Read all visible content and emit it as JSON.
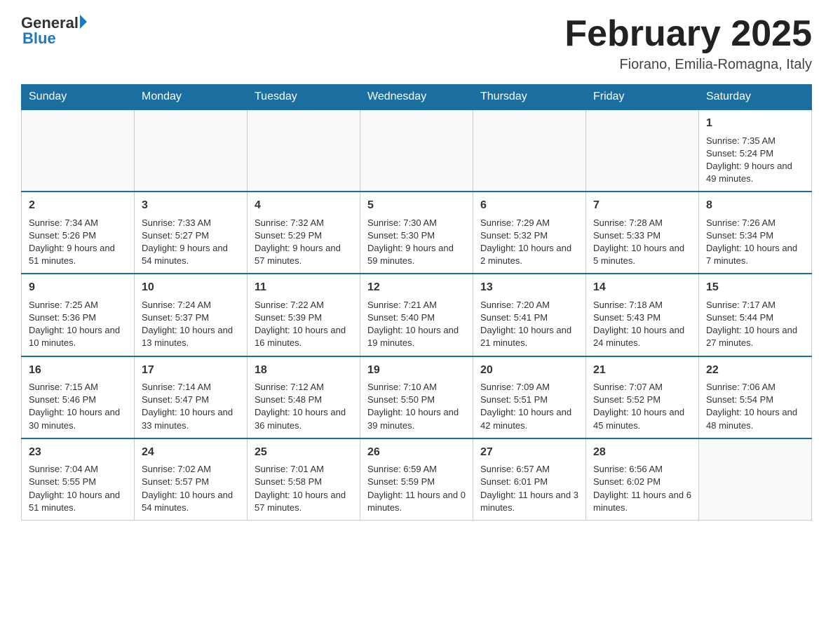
{
  "logo": {
    "text_general": "General",
    "text_blue": "Blue"
  },
  "header": {
    "month": "February 2025",
    "location": "Fiorano, Emilia-Romagna, Italy"
  },
  "weekdays": [
    "Sunday",
    "Monday",
    "Tuesday",
    "Wednesday",
    "Thursday",
    "Friday",
    "Saturday"
  ],
  "weeks": [
    [
      {
        "day": "",
        "info": ""
      },
      {
        "day": "",
        "info": ""
      },
      {
        "day": "",
        "info": ""
      },
      {
        "day": "",
        "info": ""
      },
      {
        "day": "",
        "info": ""
      },
      {
        "day": "",
        "info": ""
      },
      {
        "day": "1",
        "info": "Sunrise: 7:35 AM\nSunset: 5:24 PM\nDaylight: 9 hours and 49 minutes."
      }
    ],
    [
      {
        "day": "2",
        "info": "Sunrise: 7:34 AM\nSunset: 5:26 PM\nDaylight: 9 hours and 51 minutes."
      },
      {
        "day": "3",
        "info": "Sunrise: 7:33 AM\nSunset: 5:27 PM\nDaylight: 9 hours and 54 minutes."
      },
      {
        "day": "4",
        "info": "Sunrise: 7:32 AM\nSunset: 5:29 PM\nDaylight: 9 hours and 57 minutes."
      },
      {
        "day": "5",
        "info": "Sunrise: 7:30 AM\nSunset: 5:30 PM\nDaylight: 9 hours and 59 minutes."
      },
      {
        "day": "6",
        "info": "Sunrise: 7:29 AM\nSunset: 5:32 PM\nDaylight: 10 hours and 2 minutes."
      },
      {
        "day": "7",
        "info": "Sunrise: 7:28 AM\nSunset: 5:33 PM\nDaylight: 10 hours and 5 minutes."
      },
      {
        "day": "8",
        "info": "Sunrise: 7:26 AM\nSunset: 5:34 PM\nDaylight: 10 hours and 7 minutes."
      }
    ],
    [
      {
        "day": "9",
        "info": "Sunrise: 7:25 AM\nSunset: 5:36 PM\nDaylight: 10 hours and 10 minutes."
      },
      {
        "day": "10",
        "info": "Sunrise: 7:24 AM\nSunset: 5:37 PM\nDaylight: 10 hours and 13 minutes."
      },
      {
        "day": "11",
        "info": "Sunrise: 7:22 AM\nSunset: 5:39 PM\nDaylight: 10 hours and 16 minutes."
      },
      {
        "day": "12",
        "info": "Sunrise: 7:21 AM\nSunset: 5:40 PM\nDaylight: 10 hours and 19 minutes."
      },
      {
        "day": "13",
        "info": "Sunrise: 7:20 AM\nSunset: 5:41 PM\nDaylight: 10 hours and 21 minutes."
      },
      {
        "day": "14",
        "info": "Sunrise: 7:18 AM\nSunset: 5:43 PM\nDaylight: 10 hours and 24 minutes."
      },
      {
        "day": "15",
        "info": "Sunrise: 7:17 AM\nSunset: 5:44 PM\nDaylight: 10 hours and 27 minutes."
      }
    ],
    [
      {
        "day": "16",
        "info": "Sunrise: 7:15 AM\nSunset: 5:46 PM\nDaylight: 10 hours and 30 minutes."
      },
      {
        "day": "17",
        "info": "Sunrise: 7:14 AM\nSunset: 5:47 PM\nDaylight: 10 hours and 33 minutes."
      },
      {
        "day": "18",
        "info": "Sunrise: 7:12 AM\nSunset: 5:48 PM\nDaylight: 10 hours and 36 minutes."
      },
      {
        "day": "19",
        "info": "Sunrise: 7:10 AM\nSunset: 5:50 PM\nDaylight: 10 hours and 39 minutes."
      },
      {
        "day": "20",
        "info": "Sunrise: 7:09 AM\nSunset: 5:51 PM\nDaylight: 10 hours and 42 minutes."
      },
      {
        "day": "21",
        "info": "Sunrise: 7:07 AM\nSunset: 5:52 PM\nDaylight: 10 hours and 45 minutes."
      },
      {
        "day": "22",
        "info": "Sunrise: 7:06 AM\nSunset: 5:54 PM\nDaylight: 10 hours and 48 minutes."
      }
    ],
    [
      {
        "day": "23",
        "info": "Sunrise: 7:04 AM\nSunset: 5:55 PM\nDaylight: 10 hours and 51 minutes."
      },
      {
        "day": "24",
        "info": "Sunrise: 7:02 AM\nSunset: 5:57 PM\nDaylight: 10 hours and 54 minutes."
      },
      {
        "day": "25",
        "info": "Sunrise: 7:01 AM\nSunset: 5:58 PM\nDaylight: 10 hours and 57 minutes."
      },
      {
        "day": "26",
        "info": "Sunrise: 6:59 AM\nSunset: 5:59 PM\nDaylight: 11 hours and 0 minutes."
      },
      {
        "day": "27",
        "info": "Sunrise: 6:57 AM\nSunset: 6:01 PM\nDaylight: 11 hours and 3 minutes."
      },
      {
        "day": "28",
        "info": "Sunrise: 6:56 AM\nSunset: 6:02 PM\nDaylight: 11 hours and 6 minutes."
      },
      {
        "day": "",
        "info": ""
      }
    ]
  ]
}
